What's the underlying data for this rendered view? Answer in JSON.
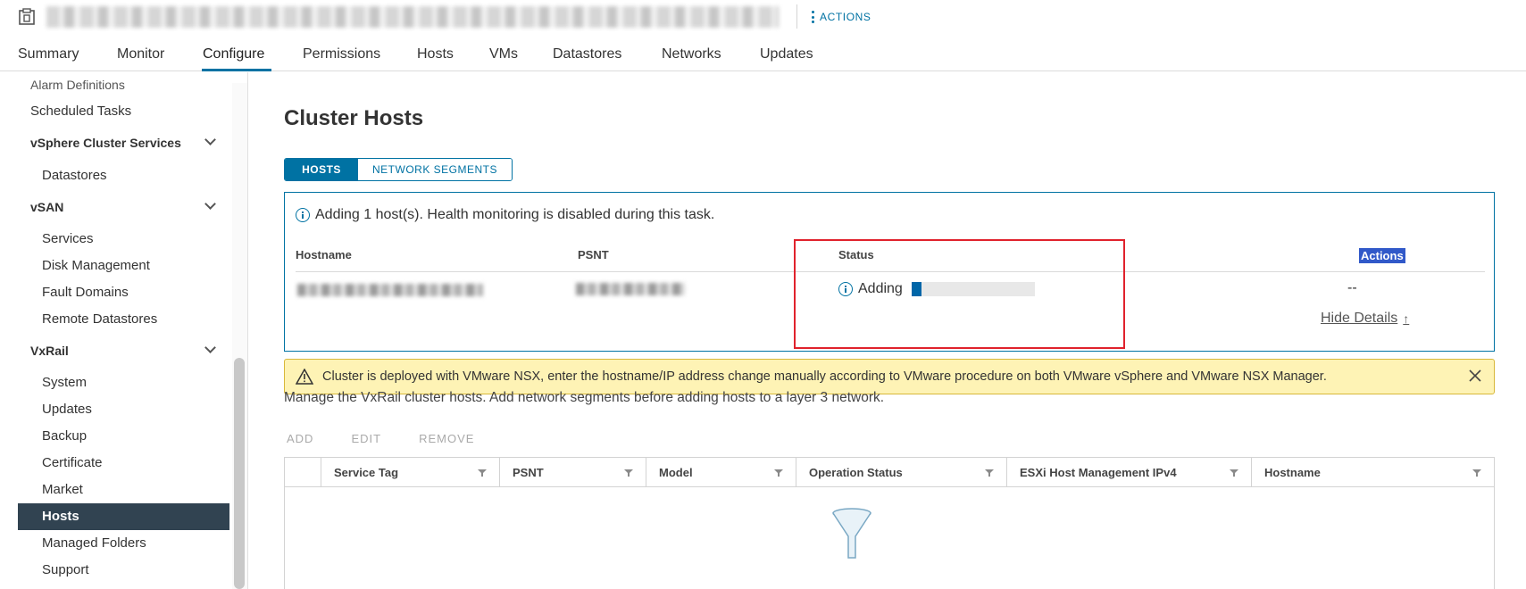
{
  "header": {
    "object_icon": "vsphere-cluster-icon",
    "title_redacted": true,
    "actions_label": "ACTIONS"
  },
  "tabs": [
    {
      "label": "Summary",
      "active": false
    },
    {
      "label": "Monitor",
      "active": false
    },
    {
      "label": "Configure",
      "active": true
    },
    {
      "label": "Permissions",
      "active": false
    },
    {
      "label": "Hosts",
      "active": false
    },
    {
      "label": "VMs",
      "active": false
    },
    {
      "label": "Datastores",
      "active": false
    },
    {
      "label": "Networks",
      "active": false
    },
    {
      "label": "Updates",
      "active": false
    }
  ],
  "sidebar": {
    "items": [
      {
        "label": "Alarm Definitions"
      },
      {
        "label": "Scheduled Tasks"
      },
      {
        "label": "vSphere Cluster Services"
      },
      {
        "label": "Datastores"
      },
      {
        "label": "vSAN"
      },
      {
        "label": "Services"
      },
      {
        "label": "Disk Management"
      },
      {
        "label": "Fault Domains"
      },
      {
        "label": "Remote Datastores"
      },
      {
        "label": "VxRail"
      },
      {
        "label": "System"
      },
      {
        "label": "Updates"
      },
      {
        "label": "Backup"
      },
      {
        "label": "Certificate"
      },
      {
        "label": "Market"
      },
      {
        "label": "Hosts"
      },
      {
        "label": "Managed Folders"
      },
      {
        "label": "Support"
      }
    ],
    "selected": "Hosts"
  },
  "main": {
    "title": "Cluster Hosts",
    "segments": {
      "hosts": "HOSTS",
      "network_segments": "NETWORK SEGMENTS"
    },
    "task": {
      "message": "Adding 1 host(s). Health monitoring is disabled during this task.",
      "columns": {
        "hostname": "Hostname",
        "psnt": "PSNT",
        "status": "Status",
        "actions": "Actions"
      },
      "row": {
        "status": "Adding",
        "progress_fraction": 0.08,
        "actions": "--"
      },
      "hide_details": "Hide Details"
    },
    "warning": {
      "message": "Cluster is deployed with VMware NSX, enter the hostname/IP address change manually according to VMware procedure on both VMware vSphere and VMware NSX Manager."
    },
    "description": "Manage the VxRail cluster hosts. Add network segments before adding hosts to a layer 3 network.",
    "table_actions": {
      "add": "ADD",
      "edit": "EDIT",
      "remove": "REMOVE"
    },
    "grid_columns": [
      "Service Tag",
      "PSNT",
      "Model",
      "Operation Status",
      "ESXi Host Management IPv4",
      "Hostname"
    ]
  },
  "colors": {
    "accent": "#0072a3",
    "nav_selected": "#314351",
    "warning_bg": "#fef3b5",
    "highlight_box": "#e0222c"
  }
}
